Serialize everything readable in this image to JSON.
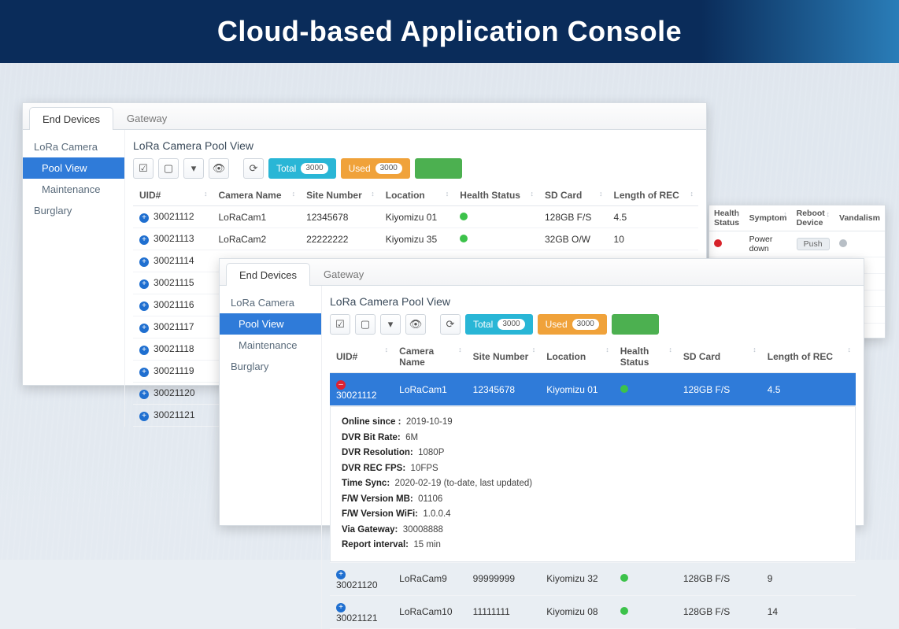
{
  "title": "Cloud-based Application Console",
  "tabs": {
    "end_devices": "End Devices",
    "gateway": "Gateway"
  },
  "sidebar": {
    "lora_camera": "LoRa Camera",
    "pool_view": "Pool View",
    "maintenance": "Maintenance",
    "burglary": "Burglary"
  },
  "section_title": "LoRa Camera Pool View",
  "badges": {
    "total_label": "Total",
    "total_count": "3000",
    "used_label": "Used",
    "used_count": "3000"
  },
  "columns": {
    "uid": "UID#",
    "camera": "Camera Name",
    "site": "Site Number",
    "location": "Location",
    "health": "Health Status",
    "sd": "SD Card",
    "rec": "Length of REC"
  },
  "columns_status": {
    "health": "Health Status",
    "symptom": "Symptom",
    "reboot": "Reboot Device",
    "vandalism": "Vandalism"
  },
  "rows_p1": [
    {
      "uid": "30021112",
      "camera": "LoRaCam1",
      "site": "12345678",
      "loc": "Kiyomizu 01",
      "hs": "green",
      "sd": "128GB F/S",
      "rec": "4.5"
    },
    {
      "uid": "30021113",
      "camera": "LoRaCam2",
      "site": "22222222",
      "loc": "Kiyomizu 35",
      "hs": "green",
      "sd": "32GB O/W",
      "rec": "10"
    },
    {
      "uid": "30021114"
    },
    {
      "uid": "30021115"
    },
    {
      "uid": "30021116"
    },
    {
      "uid": "30021117"
    },
    {
      "uid": "30021118"
    },
    {
      "uid": "30021119"
    },
    {
      "uid": "30021120"
    },
    {
      "uid": "30021121"
    }
  ],
  "selected_row": {
    "uid": "30021112",
    "camera": "LoRaCam1",
    "site": "12345678",
    "loc": "Kiyomizu 01",
    "hs": "green",
    "sd": "128GB F/S",
    "rec": "4.5"
  },
  "details": {
    "online_since_l": "Online since :",
    "online_since_v": "2019-10-19",
    "bitrate_l": "DVR Bit Rate:",
    "bitrate_v": "6M",
    "res_l": "DVR Resolution:",
    "res_v": "1080P",
    "fps_l": "DVR REC FPS:",
    "fps_v": "10FPS",
    "sync_l": "Time Sync:",
    "sync_v": "2020-02-19 (to-date, last updated)",
    "fwmb_l": "F/W Version MB:",
    "fwmb_v": "01106",
    "fwwifi_l": "F/W Version WiFi:",
    "fwwifi_v": "1.0.0.4",
    "gw_l": "Via Gateway:",
    "gw_v": "30008888",
    "interval_l": "Report interval:",
    "interval_v": "15 min"
  },
  "rows_p2_tail": [
    {
      "uid": "30021120",
      "camera": "LoRaCam9",
      "site": "99999999",
      "loc": "Kiyomizu 32",
      "hs": "green",
      "sd": "128GB F/S",
      "rec": "9"
    },
    {
      "uid": "30021121",
      "camera": "LoRaCam10",
      "site": "11111111",
      "loc": "Kiyomizu 08",
      "hs": "green",
      "sd": "128GB F/S",
      "rec": "14"
    }
  ],
  "status_row": {
    "hs": "red",
    "symptom": "Power down",
    "reboot": "Push",
    "vandalism": "gray"
  }
}
